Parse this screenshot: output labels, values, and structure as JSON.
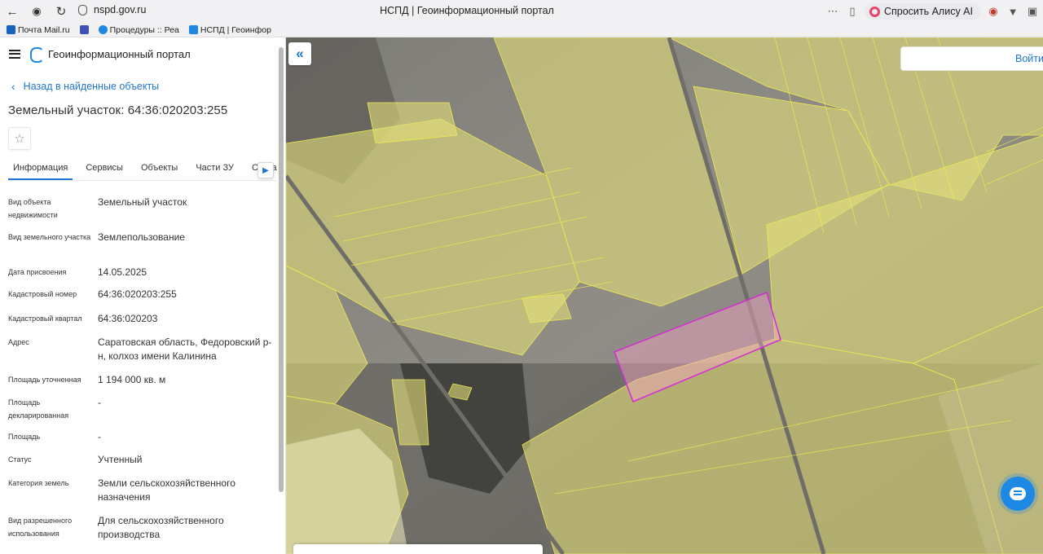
{
  "browser": {
    "url": "nspd.gov.ru",
    "title": "НСПД | Геоинформационный портал",
    "alice_label": "Спросить Алису AI",
    "icons": [
      "back-arrow-icon",
      "yandex-logo-icon",
      "reload-icon",
      "shield-icon",
      "menu-dots-icon",
      "bookmark-icon",
      "extension-icon",
      "download-icon",
      "tabs-icon"
    ]
  },
  "bookmarks": [
    {
      "label": "Почта Mail.ru",
      "color": "#1565c0"
    },
    {
      "label": "",
      "color": "#3f51b5"
    },
    {
      "label": "Процедуры :: Реа",
      "color": "#1e88e5"
    },
    {
      "label": "НСПД | Геоинфор",
      "color": "#1e88e5"
    }
  ],
  "header": {
    "portal_name": "Геоинформационный портал"
  },
  "back_link": "Назад в найденные объекты",
  "object_title": "Земельный участок: 64:36:020203:255",
  "tabs": [
    {
      "label": "Информация",
      "active": true
    },
    {
      "label": "Сервисы",
      "active": false
    },
    {
      "label": "Объекты",
      "active": false
    },
    {
      "label": "Части ЗУ",
      "active": false
    },
    {
      "label": "Соста",
      "active": false
    }
  ],
  "properties": [
    {
      "label": "Вид объекта недвижимости",
      "value": "Земельный участок"
    },
    {
      "label": "Вид земельного участка",
      "value": "Землепользование"
    },
    {
      "label": "Дата присвоения",
      "value": "14.05.2025"
    },
    {
      "label": "Кадастровый номер",
      "value": "64:36:020203:255"
    },
    {
      "label": "Кадастровый квартал",
      "value": "64:36:020203"
    },
    {
      "label": "Адрес",
      "value": "Саратовская область, Федоровский р-н, колхоз имени Калинина"
    },
    {
      "label": "Площадь уточненная",
      "value": "1 194 000 кв. м"
    },
    {
      "label": "Площадь декларированная",
      "value": "-"
    },
    {
      "label": "Площадь",
      "value": "-"
    },
    {
      "label": "Статус",
      "value": "Учтенный"
    },
    {
      "label": "Категория земель",
      "value": "Земли сельскохозяйственного назначения"
    },
    {
      "label": "Вид разрешенного использования",
      "value": "Для сельскохозяйственного производства"
    }
  ],
  "map": {
    "login_label": "Войти",
    "parcel_fill": "#e6e081",
    "parcel_stroke": "#f2ec55",
    "selected_stroke": "#d62ad6",
    "selected_fill": "#f4a4c4"
  }
}
